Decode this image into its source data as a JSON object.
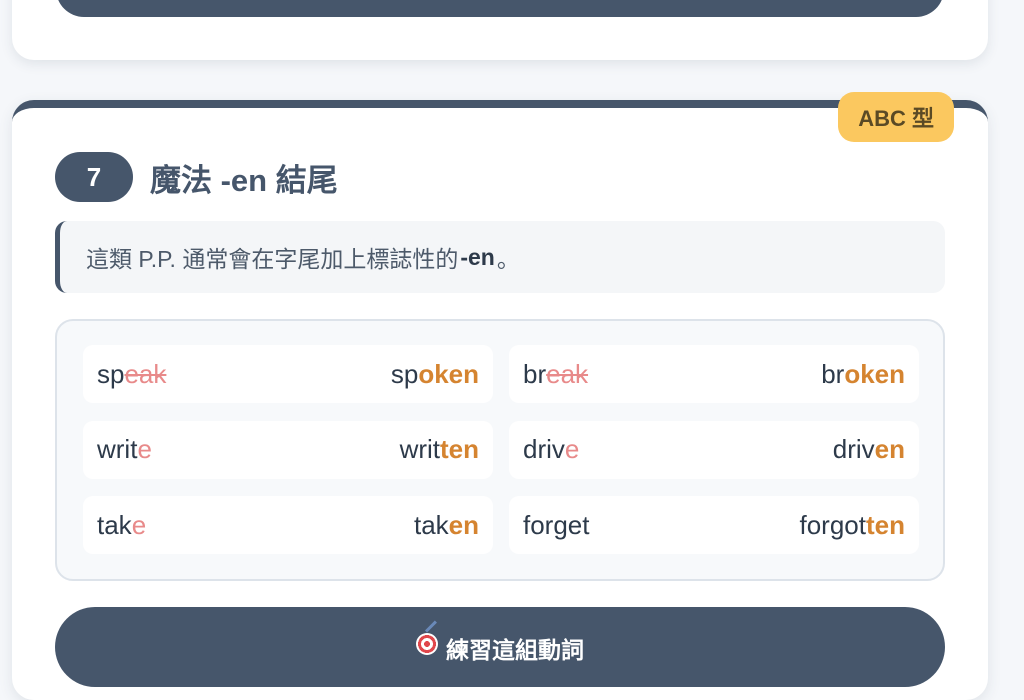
{
  "section": {
    "number": "7",
    "title": "魔法 -en 結尾",
    "type_badge": "ABC 型",
    "description": {
      "text_before": "這類 P.P. 通常會在字尾加上標誌性的",
      "highlight": "-en",
      "text_after": "。"
    }
  },
  "verbs": [
    {
      "base": {
        "stem": "sp",
        "removed": "eak",
        "style": "del"
      },
      "pp": {
        "stem": "sp",
        "suffix": "oken"
      }
    },
    {
      "base": {
        "stem": "br",
        "removed": "eak",
        "style": "del"
      },
      "pp": {
        "stem": "br",
        "suffix": "oken"
      }
    },
    {
      "base": {
        "stem": "writ",
        "removed": "e",
        "style": "drop"
      },
      "pp": {
        "stem": "writ",
        "suffix": "ten"
      }
    },
    {
      "base": {
        "stem": "driv",
        "removed": "e",
        "style": "drop"
      },
      "pp": {
        "stem": "driv",
        "suffix": "en"
      }
    },
    {
      "base": {
        "stem": "tak",
        "removed": "e",
        "style": "drop"
      },
      "pp": {
        "stem": "tak",
        "suffix": "en"
      }
    },
    {
      "base": {
        "stem": "forget",
        "removed": "",
        "style": "drop"
      },
      "pp": {
        "stem": "forgot",
        "suffix": "ten"
      }
    }
  ],
  "practice_button": {
    "icon": "target-icon",
    "label": "練習這組動詞"
  },
  "colors": {
    "primary": "#46566b",
    "badge": "#fbc85f",
    "suffix": "#d58430",
    "removed": "#e88a8a"
  }
}
